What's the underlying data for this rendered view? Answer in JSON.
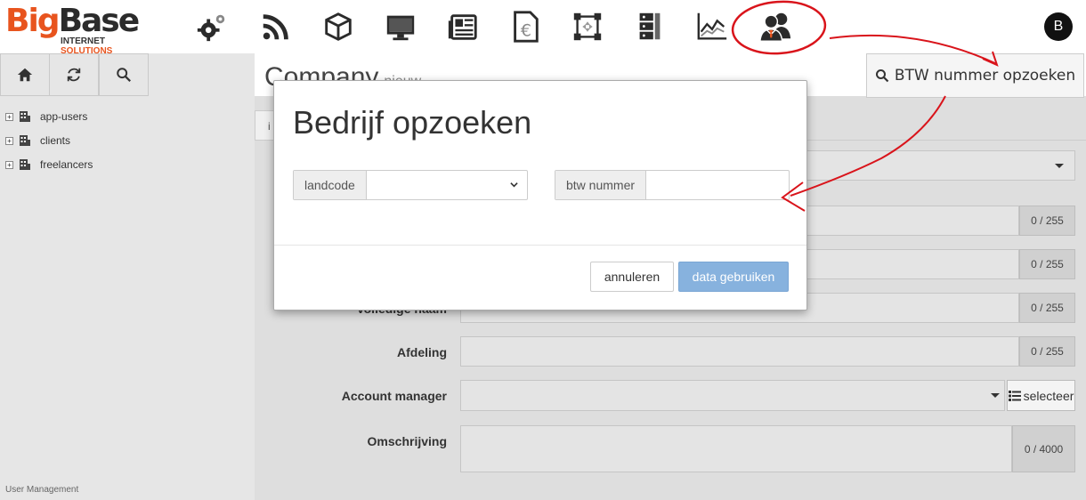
{
  "logo": {
    "big_1": "Big",
    "big_2": "Base",
    "sub_1": "INTERNET ",
    "sub_2": "SOLUTIONS"
  },
  "nav_icons": [
    "gears-icon",
    "rss-icon",
    "box-icon",
    "monitor-icon",
    "newspaper-icon",
    "euro-document-icon",
    "crop-icon",
    "server-icon",
    "line-chart-icon",
    "users-icon"
  ],
  "user": {
    "avatar_letter": "B"
  },
  "sidebar": {
    "buttons": [
      "home-icon",
      "refresh-icon",
      "search-icon"
    ],
    "tree": [
      {
        "label": "app-users"
      },
      {
        "label": "clients"
      },
      {
        "label": "freelancers"
      }
    ],
    "footer": "User Management"
  },
  "main": {
    "title": "Company",
    "title_suffix": "nieuw",
    "btw_button": "BTW nummer opzoeken",
    "tab_ghost": "i",
    "counters": [
      "0 / 255",
      "0 / 255",
      "0 / 255",
      "0 / 255",
      "0 / 4000"
    ],
    "labels": {
      "volledige_naam": "Volledige naam",
      "afdeling": "Afdeling",
      "account_manager": "Account manager",
      "omschrijving": "Omschrijving"
    },
    "selecteer": "selecteer"
  },
  "modal": {
    "title": "Bedrijf opzoeken",
    "landcode_label": "landcode",
    "landcode_value": "",
    "btw_label": "btw nummer",
    "btw_value": "",
    "cancel": "annuleren",
    "use": "data gebruiken"
  },
  "colors": {
    "accent": "#e8541e",
    "primary_button": "#87b2de",
    "annotation": "#d9141b"
  }
}
